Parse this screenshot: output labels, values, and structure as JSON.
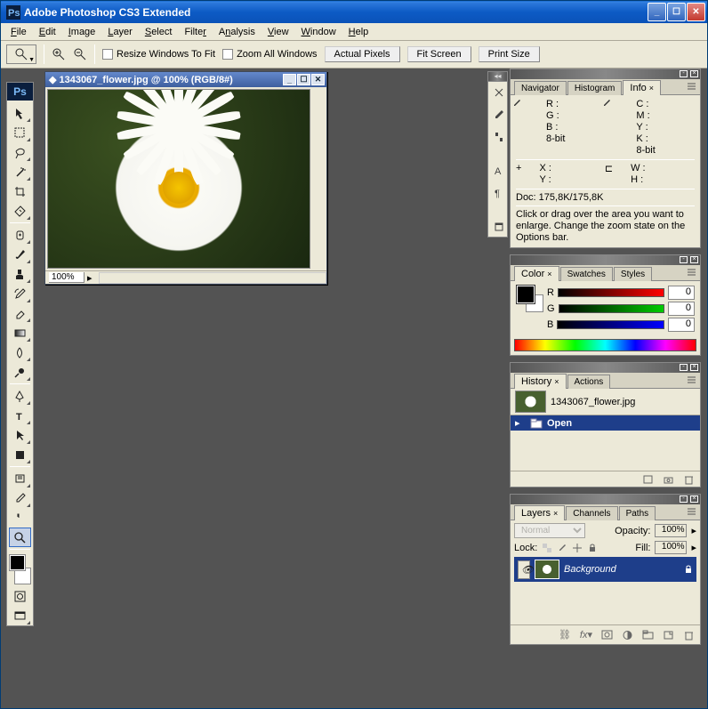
{
  "title": "Adobe Photoshop CS3 Extended",
  "menu": [
    "File",
    "Edit",
    "Image",
    "Layer",
    "Select",
    "Filter",
    "Analysis",
    "View",
    "Window",
    "Help"
  ],
  "options": {
    "resize_windows": "Resize Windows To Fit",
    "zoom_all": "Zoom All Windows",
    "actual_pixels": "Actual Pixels",
    "fit_screen": "Fit Screen",
    "print_size": "Print Size"
  },
  "document": {
    "title": "1343067_flower.jpg @ 100% (RGB/8#)",
    "zoom": "100%"
  },
  "panels": {
    "info_tabs": [
      "Navigator",
      "Histogram",
      "Info"
    ],
    "info": {
      "r": "R :",
      "g": "G :",
      "b": "B :",
      "bit1": "8-bit",
      "c": "C :",
      "m": "M :",
      "y": "Y :",
      "k": "K :",
      "bit2": "8-bit",
      "x": "X :",
      "yy": "Y :",
      "w": "W :",
      "h": "H :",
      "doc": "Doc: 175,8K/175,8K",
      "hint": "Click or drag over the area you want to enlarge. Change the zoom state on the Options bar."
    },
    "color_tabs": [
      "Color",
      "Swatches",
      "Styles"
    ],
    "color": {
      "r": "R",
      "g": "G",
      "b": "B",
      "rv": "0",
      "gv": "0",
      "bv": "0"
    },
    "history_tabs": [
      "History",
      "Actions"
    ],
    "history": {
      "file": "1343067_flower.jpg",
      "open": "Open"
    },
    "layers_tabs": [
      "Layers",
      "Channels",
      "Paths"
    ],
    "layers": {
      "mode": "Normal",
      "opacity_label": "Opacity:",
      "opacity": "100%",
      "lock": "Lock:",
      "fill_label": "Fill:",
      "fill": "100%",
      "bg": "Background"
    }
  }
}
